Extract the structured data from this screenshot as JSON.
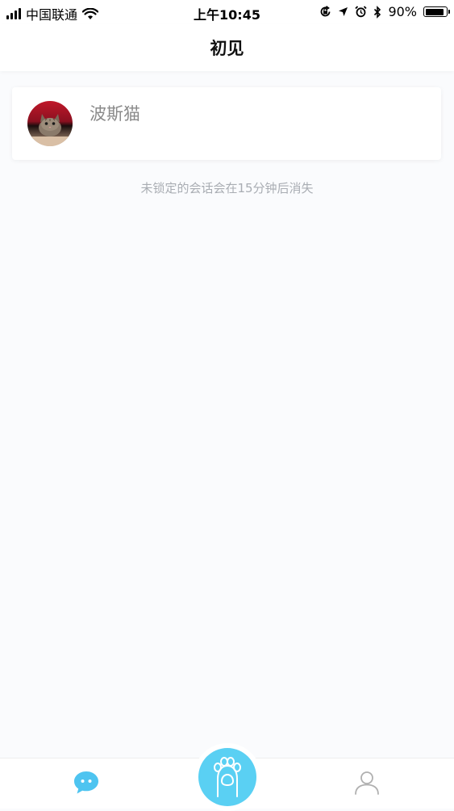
{
  "status_bar": {
    "carrier": "中国联通",
    "time": "上午10:45",
    "battery_percent": "90%",
    "battery_level": 0.9
  },
  "nav": {
    "title": "初见"
  },
  "sessions": [
    {
      "name": "波斯猫",
      "avatar_icon": "cat-avatar-icon"
    }
  ],
  "notice": "未锁定的会话会在15分钟后消失",
  "tab_bar": {
    "items": [
      {
        "icon": "chat-bubble-icon",
        "active": true
      },
      {
        "icon": "paw-icon",
        "active": false
      },
      {
        "icon": "person-icon",
        "active": false
      }
    ]
  },
  "colors": {
    "accent": "#4ec4f0",
    "paw_button": "#5ad0f3",
    "muted_text": "#a9adb3",
    "inactive_icon": "#b0b0b0"
  }
}
